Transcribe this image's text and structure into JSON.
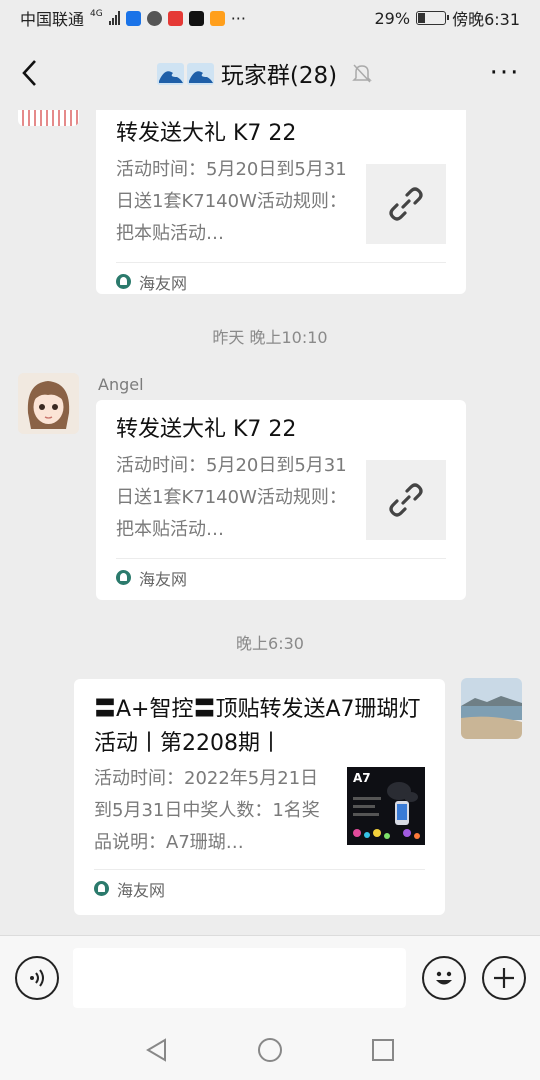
{
  "status_bar": {
    "carrier": "中国联通",
    "network": "4G",
    "battery_percent_text": "29%",
    "battery_level": 0.29,
    "time": "傍晚6:31",
    "more": "···",
    "icons": [
      "signal-icon",
      "shield-app-icon",
      "shield-check-icon",
      "toutiao-app-icon",
      "tiktok-app-icon",
      "orange-app-icon"
    ]
  },
  "header": {
    "title": "玩家群(28)",
    "back_icon": "chevron-left-icon",
    "mute_icon": "bell-muted-icon",
    "more_icon": "more-dots-icon",
    "more_text": "···"
  },
  "messages": [
    {
      "title": "转发送大礼 K7 22",
      "desc": "活动时间：5月20日到5月31日送1套K7140W活动规则：把本贴活动…",
      "source": "海友网",
      "thumb_icon": "link-icon"
    },
    {
      "timestamp": "昨天 晚上10:10",
      "sender": "Angel",
      "title": "转发送大礼 K7 22",
      "desc": "活动时间：5月20日到5月31日送1套K7140W活动规则：把本贴活动…",
      "source": "海友网",
      "thumb_icon": "link-icon"
    },
    {
      "timestamp": "晚上6:30",
      "title": "〓A+智控〓顶贴转发送A7珊瑚灯活动丨第2208期丨",
      "desc": "活动时间：2022年5月21日到5月31日中奖人数：1名奖品说明：A7珊瑚…",
      "source": "海友网",
      "thumb_label": "A7"
    }
  ],
  "input_bar": {
    "voice_icon": "voice-icon",
    "emoji_icon": "emoji-icon",
    "add_icon": "plus-circle-icon",
    "placeholder": ""
  },
  "nav_bar": {
    "icons": [
      "back-triangle-icon",
      "home-circle-icon",
      "recents-square-icon"
    ]
  }
}
